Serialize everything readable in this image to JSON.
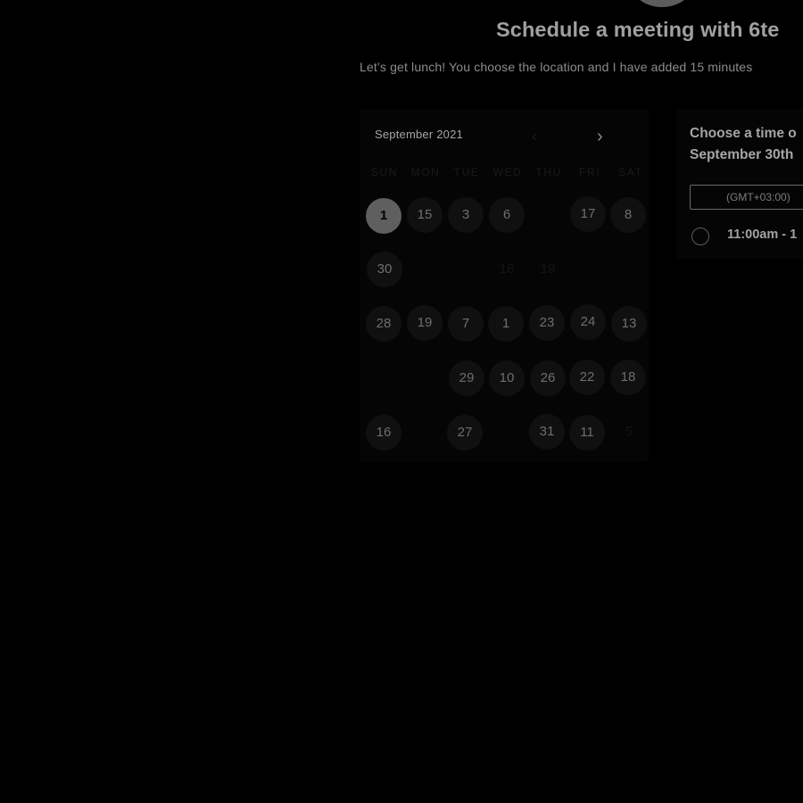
{
  "header": {
    "title": "Schedule a meeting with 6te",
    "subtitle": "Let’s get lunch! You choose the location and I have added 15 minutes"
  },
  "calendar": {
    "month_label": "September 2021",
    "prev_icon": "chevron-left-icon",
    "next_icon": "chevron-right-icon",
    "weekdays": [
      "SUN",
      "MON",
      "TUE",
      "WED",
      "THU",
      "FRI",
      "SAT"
    ],
    "weeks": [
      [
        "1",
        "15",
        "3",
        "6",
        "",
        "17",
        "8"
      ],
      [
        "30",
        "",
        "",
        "18",
        "19",
        "",
        ""
      ],
      [
        "28",
        "19",
        "7",
        "1",
        "23",
        "24",
        "13"
      ],
      [
        "",
        "",
        "29",
        "10",
        "26",
        "22",
        "18"
      ],
      [
        "16",
        "",
        "27",
        "",
        "31",
        "11",
        "5"
      ]
    ],
    "selected": "1"
  },
  "time_panel": {
    "heading_line1": "Choose a time o",
    "heading_line2": "September 30th",
    "timezone": "(GMT+03:00)",
    "slots": [
      "11:00am - 1"
    ]
  }
}
